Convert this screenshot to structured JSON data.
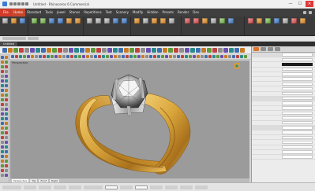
{
  "app": {
    "title": "Untitled - Rhinoceros 6 Commercial"
  },
  "window_controls": {
    "minimize": "—",
    "maximize": "☐",
    "close": "✕"
  },
  "tabs": [
    {
      "label": "File"
    },
    {
      "label": "Home"
    },
    {
      "label": "Standard"
    },
    {
      "label": "Tools"
    },
    {
      "label": "Jewel"
    },
    {
      "label": "Stones"
    },
    {
      "label": "Repetitions"
    },
    {
      "label": "Text"
    },
    {
      "label": "Scenery"
    },
    {
      "label": "Modify"
    },
    {
      "label": "Hidden"
    },
    {
      "label": "Presets"
    },
    {
      "label": "Render"
    },
    {
      "label": "Dev"
    }
  ],
  "document_tab": {
    "label": "Untitled"
  },
  "viewport": {
    "title": "Perspective",
    "tabs": [
      "Perspective",
      "Top",
      "Front",
      "Right"
    ],
    "active": "Perspective"
  },
  "colors": {
    "accent": "#d23a2a",
    "active_tab": "#c9462c",
    "gold": "#d9a53b",
    "panel_tab_active": "#e0742c"
  },
  "icons": {
    "snap": "rotate-gumball-icon",
    "app": "rhino-icon"
  }
}
